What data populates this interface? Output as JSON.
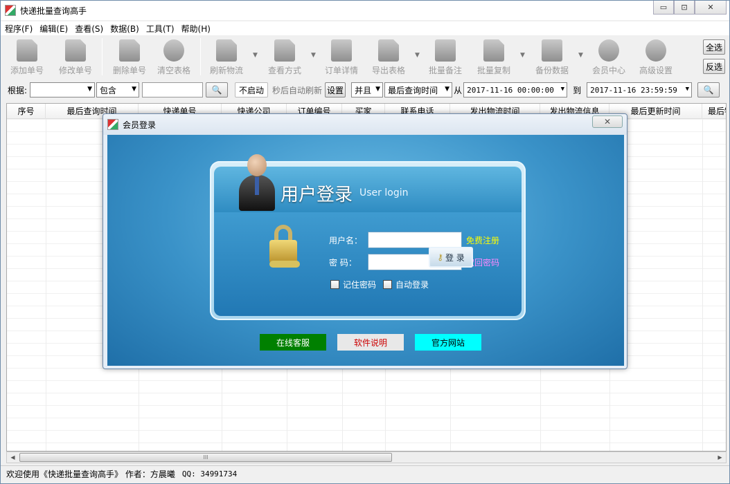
{
  "window": {
    "title": "快递批量查询高手",
    "min": "▭",
    "max": "⊡",
    "close": "✕"
  },
  "menu": [
    "程序(F)",
    "编辑(E)",
    "查看(S)",
    "数据(B)",
    "工具(T)",
    "帮助(H)"
  ],
  "toolbar": {
    "add": "添加单号",
    "edit": "修改单号",
    "delete": "删除单号",
    "clear": "清空表格",
    "refresh": "刷新物流",
    "view_mode": "查看方式",
    "order_detail": "订单详情",
    "export": "导出表格",
    "batch_note": "批量备注",
    "batch_copy": "批量复制",
    "backup": "备份数据",
    "member": "会员中心",
    "advanced": "高级设置",
    "select_all": "全选",
    "invert": "反选"
  },
  "filter": {
    "by_label": "根据:",
    "by_value": "",
    "contains": "包含",
    "keyword": "",
    "auto_status": "不启动",
    "auto_text": "秒后自动刷新",
    "settings": "设置",
    "logic": "并且",
    "time_field": "最后查询时间",
    "from_label": "从",
    "from_date": "2017-11-16 00:00:00",
    "to_label": "到",
    "to_date": "2017-11-16 23:59:59"
  },
  "columns": [
    "序号",
    "最后查询时间",
    "快递单号",
    "快递公司",
    "订单编号",
    "买家",
    "联系电话",
    "发出物流时间",
    "发出物流信息",
    "最后更新时间",
    "最后物"
  ],
  "status": {
    "text": "欢迎使用《快递批量查询高手》 作者：方晨曦",
    "qq": "QQ: 34991734"
  },
  "scroll_grip": "III",
  "dialog": {
    "title": "会员登录",
    "heading": "用户登录",
    "heading_sub": "User login",
    "username_label": "用户名：",
    "password_label": "密  码：",
    "register_link": "免费注册",
    "recover_link": "取回密码",
    "remember": "记住密码",
    "auto_login": "自动登录",
    "login_button": "登 录",
    "btn_online": "在线客服",
    "btn_manual": "软件说明",
    "btn_site": "官方网站",
    "colors": {
      "online": "#008000",
      "manual": "#e8e8e8",
      "site": "#00ffff",
      "register": "#ffff00",
      "recover": "#ff88ff"
    }
  }
}
